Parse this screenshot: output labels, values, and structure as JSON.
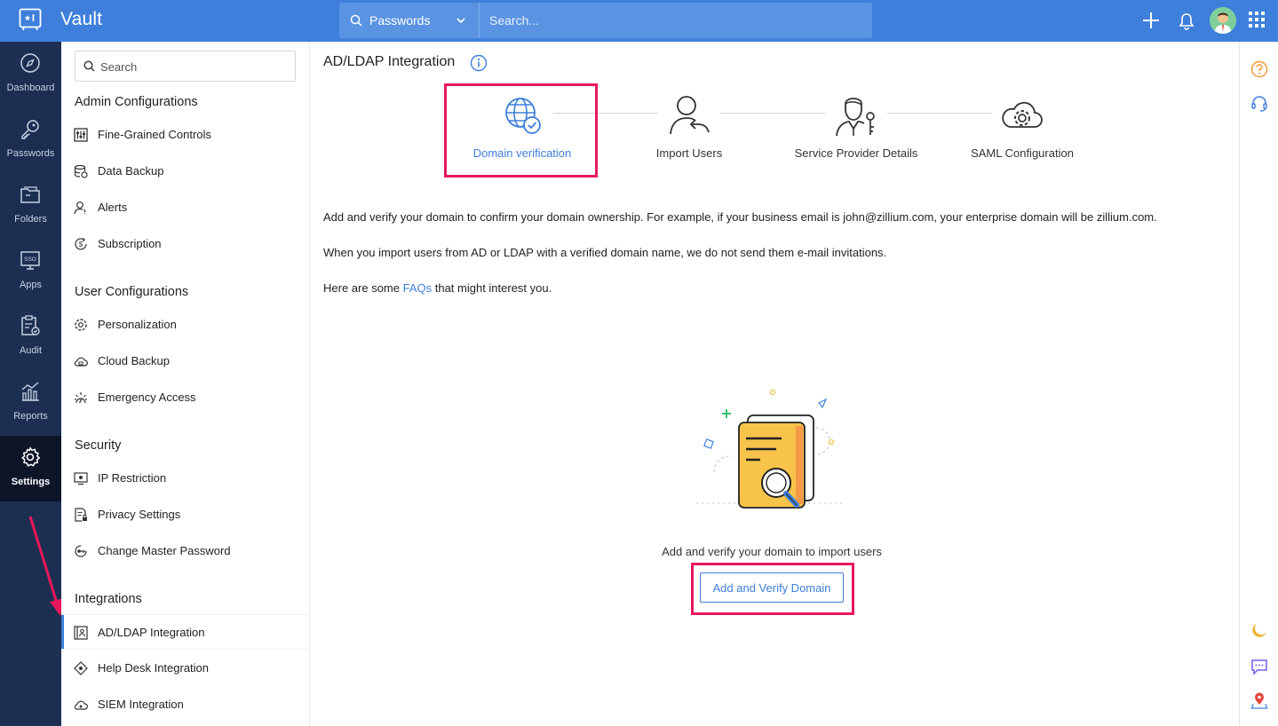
{
  "app": {
    "name": "Vault"
  },
  "topbar": {
    "search_category": "Passwords",
    "search_placeholder": "Search..."
  },
  "rail": {
    "items": [
      {
        "label": "Dashboard",
        "icon": "compass-icon"
      },
      {
        "label": "Passwords",
        "icon": "key-icon"
      },
      {
        "label": "Folders",
        "icon": "folder-icon"
      },
      {
        "label": "Apps",
        "icon": "sso-icon"
      },
      {
        "label": "Audit",
        "icon": "clipboard-icon"
      },
      {
        "label": "Reports",
        "icon": "chart-icon"
      },
      {
        "label": "Settings",
        "icon": "gear-icon",
        "active": true
      }
    ]
  },
  "nav": {
    "search_placeholder": "Search",
    "sections": [
      {
        "title": "Admin Configurations",
        "items": [
          "Fine-Grained Controls",
          "Data Backup",
          "Alerts",
          "Subscription"
        ]
      },
      {
        "title": "User Configurations",
        "items": [
          "Personalization",
          "Cloud Backup",
          "Emergency Access"
        ]
      },
      {
        "title": "Security",
        "items": [
          "IP Restriction",
          "Privacy Settings",
          "Change Master Password"
        ]
      },
      {
        "title": "Integrations",
        "items": [
          "AD/LDAP Integration",
          "Help Desk Integration",
          "SIEM Integration"
        ]
      }
    ],
    "active_item": "AD/LDAP Integration"
  },
  "main": {
    "title": "AD/LDAP Integration",
    "steps": [
      {
        "label": "Domain verification",
        "icon": "globe-check-icon",
        "active": true
      },
      {
        "label": "Import Users",
        "icon": "user-import-icon"
      },
      {
        "label": "Service Provider Details",
        "icon": "user-key-icon"
      },
      {
        "label": "SAML Configuration",
        "icon": "cloud-gear-icon"
      }
    ],
    "para1": "Add and verify your domain to confirm your domain ownership. For example, if your business email is john@zillium.com, your enterprise domain will be zillium.com.",
    "para2": "When you import users from AD or LDAP with a verified domain name, we do not send them e-mail invitations.",
    "para3_prefix": "Here are some ",
    "para3_link": "FAQs",
    "para3_suffix": " that might interest you.",
    "empty_text": "Add and verify your domain to import users",
    "cta_label": "Add and Verify Domain"
  },
  "colors": {
    "accent": "#3e7fdb",
    "rail_bg": "#1c2f52",
    "highlight": "#e8185a"
  }
}
